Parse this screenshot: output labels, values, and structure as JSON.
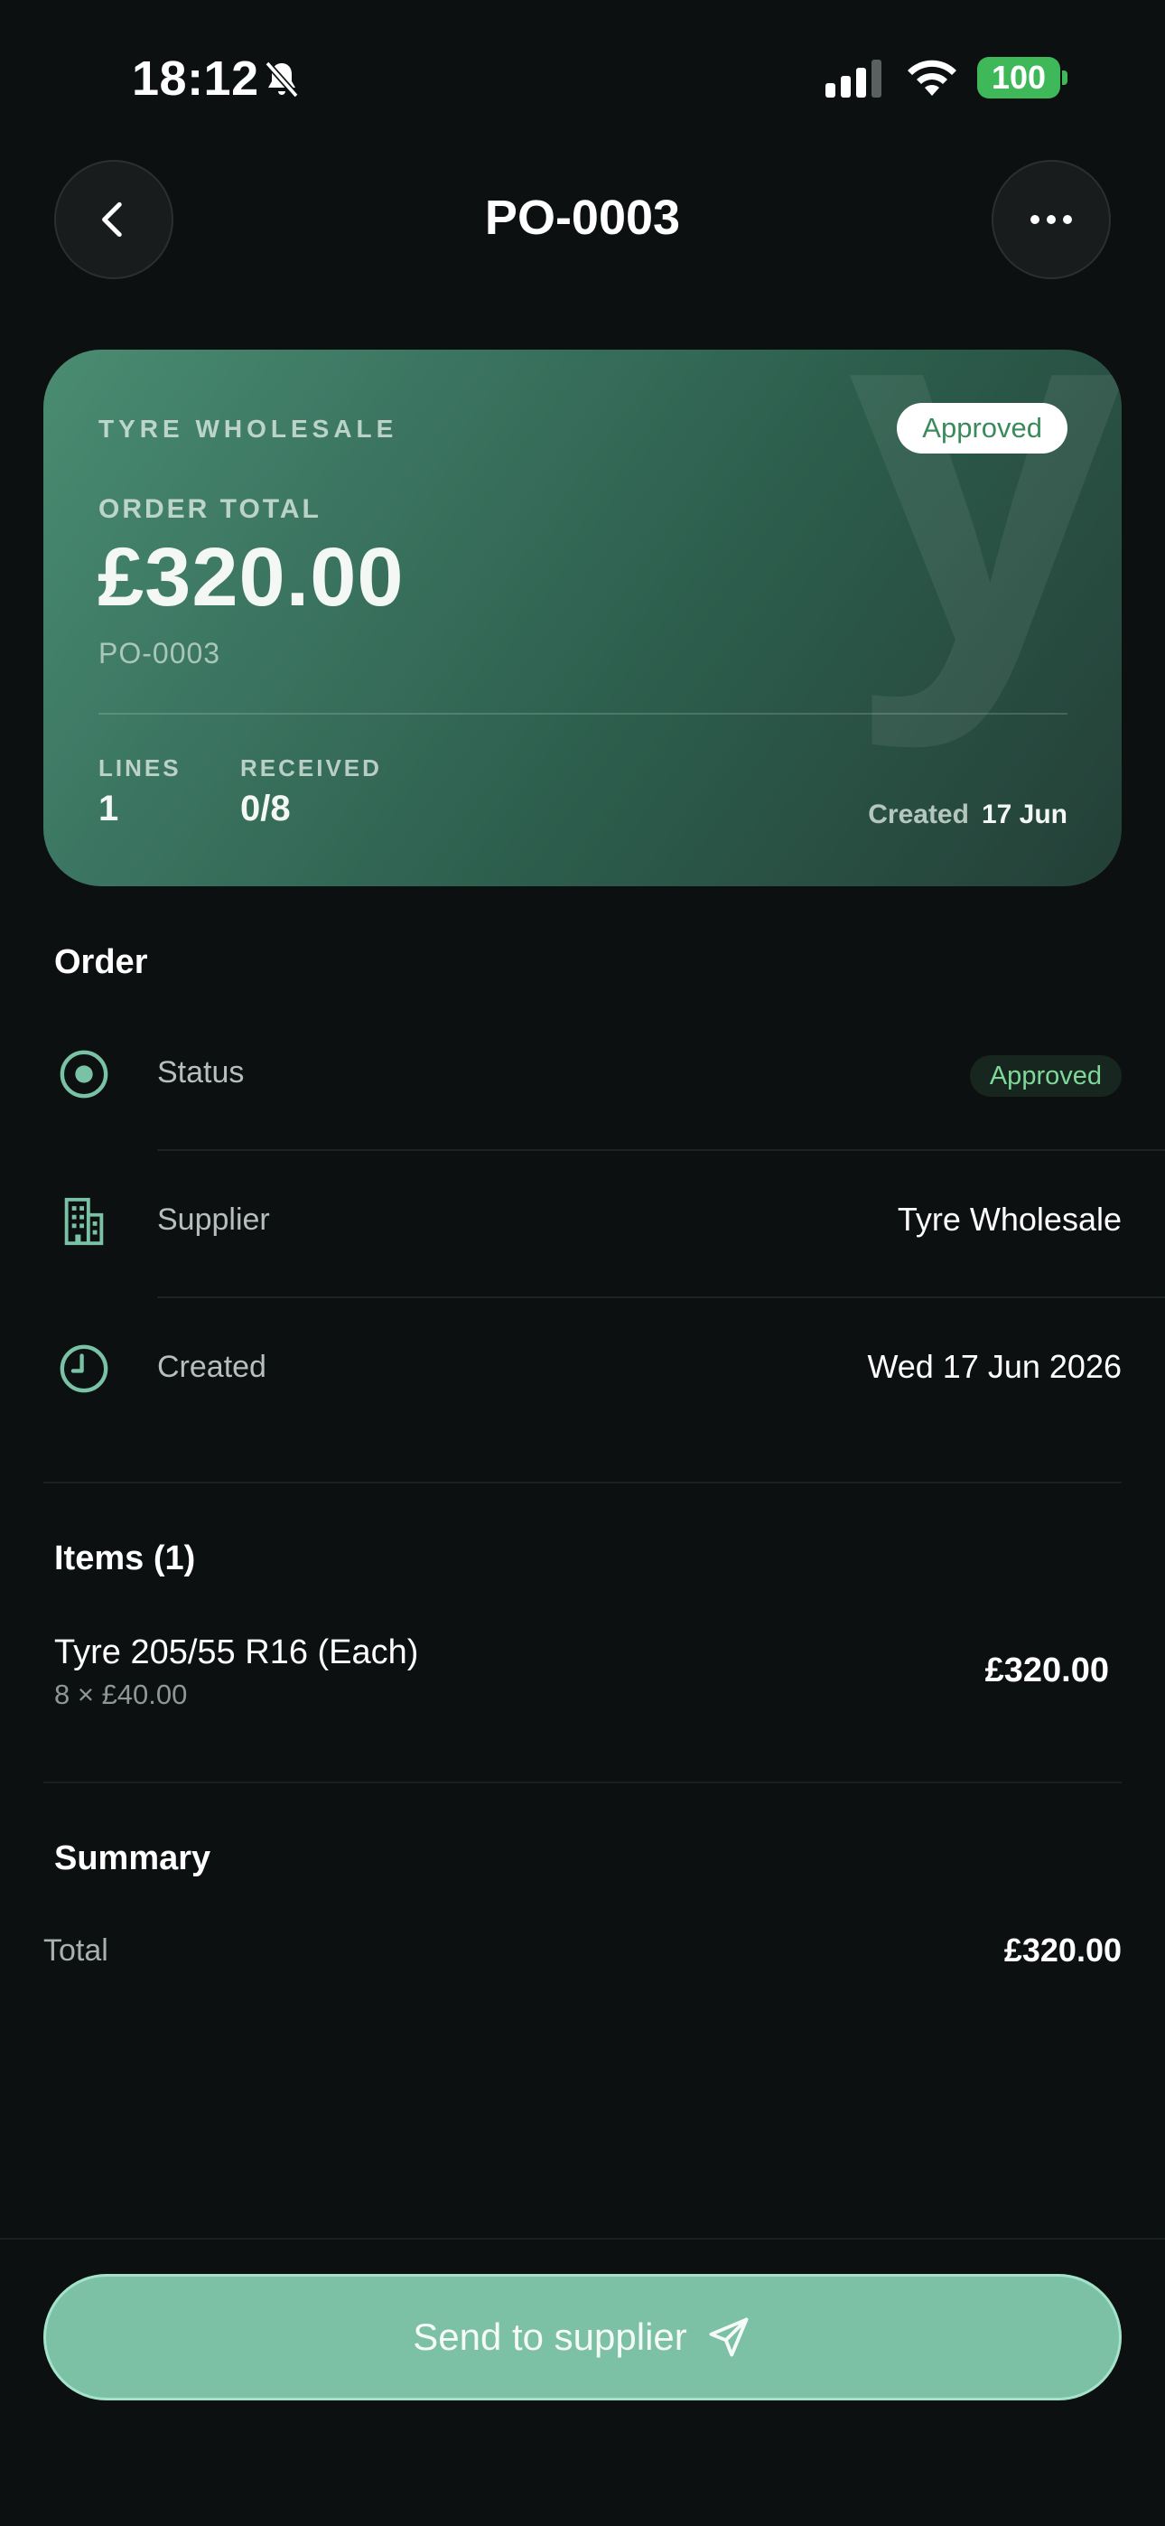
{
  "status_bar": {
    "time": "18:12",
    "battery": "100"
  },
  "header": {
    "title": "PO-0003"
  },
  "hero": {
    "supplier": "TYRE WHOLESALE",
    "status": "Approved",
    "total_label": "ORDER TOTAL",
    "total": "£320.00",
    "reference": "PO-0003",
    "lines_label": "LINES",
    "lines_value": "1",
    "received_label": "RECEIVED",
    "received_value": "0/8",
    "created_label": "Created",
    "created_value": "17 Jun",
    "watermark": "y"
  },
  "order": {
    "title": "Order",
    "rows": [
      {
        "icon": "target-icon",
        "label": "Status",
        "value": "Approved"
      },
      {
        "icon": "building-icon",
        "label": "Supplier",
        "value": "Tyre Wholesale"
      },
      {
        "icon": "clock-icon",
        "label": "Created",
        "value": "Wed 17 Jun 2026"
      }
    ]
  },
  "items": {
    "title": "Items (1)",
    "list": [
      {
        "name": "Tyre 205/55 R16 (Each)",
        "qty": "8 × £40.00",
        "price": "£320.00"
      }
    ]
  },
  "summary": {
    "title": "Summary",
    "total_label": "Total",
    "total_value": "£320.00"
  },
  "actions": {
    "send_label": "Send to supplier"
  },
  "colors": {
    "accent": "#7cc0a6",
    "approved_text": "#3b8a5c",
    "background": "#0c1010"
  }
}
